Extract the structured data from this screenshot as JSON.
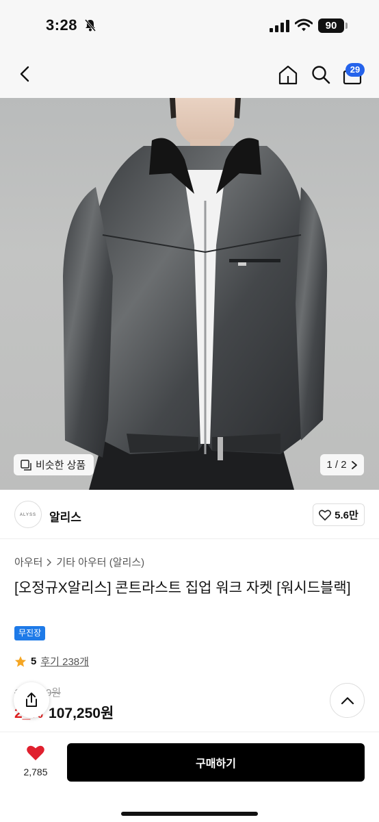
{
  "status": {
    "time": "3:28",
    "battery": "90"
  },
  "nav": {
    "cart_count": "29"
  },
  "hero": {
    "similar_label": "비슷한 상품",
    "page_indicator": "1 / 2"
  },
  "brand": {
    "logo_text": "ALYSS",
    "name": "알리스",
    "likes": "5.6만"
  },
  "product": {
    "category_root": "아우터",
    "category_sub": "기타 아우터 (알리스)",
    "title": "[오정규X알리스] 콘트라스트 집업 워크 자켓 [워시드블랙]",
    "tag": "무진장",
    "rating": "5",
    "reviews": "후기 238개",
    "original_price": "1__,_00원",
    "discount": "2_%",
    "price": "107,250원"
  },
  "bottom": {
    "like_count": "2,785",
    "buy_label": "구매하기"
  },
  "colors": {
    "accent_blue": "#2563eb",
    "tag_blue": "#1e7ae8",
    "heart_red": "#e0202e",
    "buy_black": "#000000"
  },
  "icons": [
    "bell-slash-icon",
    "signal-icon",
    "wifi-icon",
    "back-chevron-icon",
    "home-icon",
    "search-icon",
    "cart-icon",
    "similar-icon",
    "chevron-right-icon",
    "heart-outline-icon",
    "star-icon",
    "share-icon",
    "chevron-up-icon",
    "heart-filled-icon"
  ]
}
